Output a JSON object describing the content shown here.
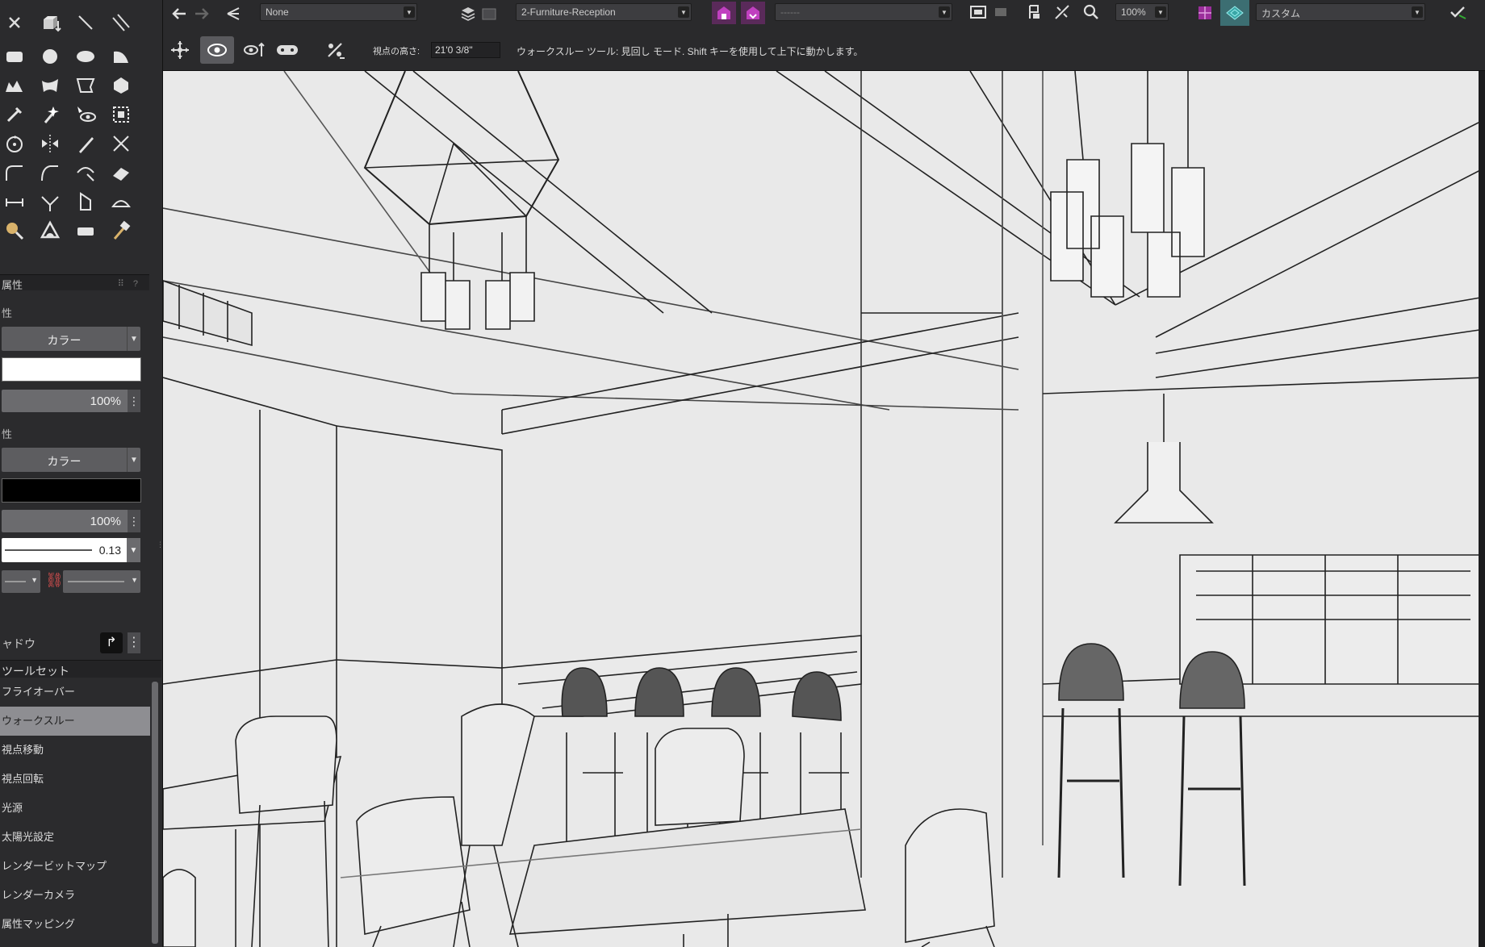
{
  "left_panel": {
    "attributes_title": "属性",
    "fill_section_label": "性",
    "fill_dropdown": "カラー",
    "fill_color": "#ffffff",
    "fill_opacity": "100%",
    "pen_section_label": "性",
    "pen_dropdown": "カラー",
    "pen_color": "#000000",
    "pen_opacity": "100%",
    "line_weight": "0.13",
    "shadow_label": "ャドウ",
    "toolset_title": "ツールセット",
    "toolset_items": [
      {
        "label": "フライオーバー",
        "selected": false
      },
      {
        "label": "ウォークスルー",
        "selected": true
      },
      {
        "label": "視点移動",
        "selected": false
      },
      {
        "label": "視点回転",
        "selected": false
      },
      {
        "label": "光源",
        "selected": false
      },
      {
        "label": "太陽光設定",
        "selected": false
      },
      {
        "label": "レンダービットマップ",
        "selected": false
      },
      {
        "label": "レンダーカメラ",
        "selected": false
      },
      {
        "label": "属性マッピング",
        "selected": false
      }
    ]
  },
  "top_bar": {
    "class_dropdown": "None",
    "layer_dropdown": "2-Furniture-Reception",
    "saved_view_dropdown": "------",
    "zoom_dropdown": "100%",
    "render_mode_dropdown": "カスタム",
    "eye_height_label": "視点の高さ:",
    "eye_height_value": "21'0 3/8\"",
    "help_text": "ウォークスルー ツール: 見回し モード. Shift キーを使用して上下に動かします。"
  },
  "colors": {
    "panel_bg": "#2b2b2d",
    "toolbar_bg": "#2a2a2c",
    "viewport_bg": "#e9e9e9",
    "accent_purple": "#9b2e9b",
    "accent_teal": "#3aa6a6",
    "selected_item": "#8e8e92"
  }
}
